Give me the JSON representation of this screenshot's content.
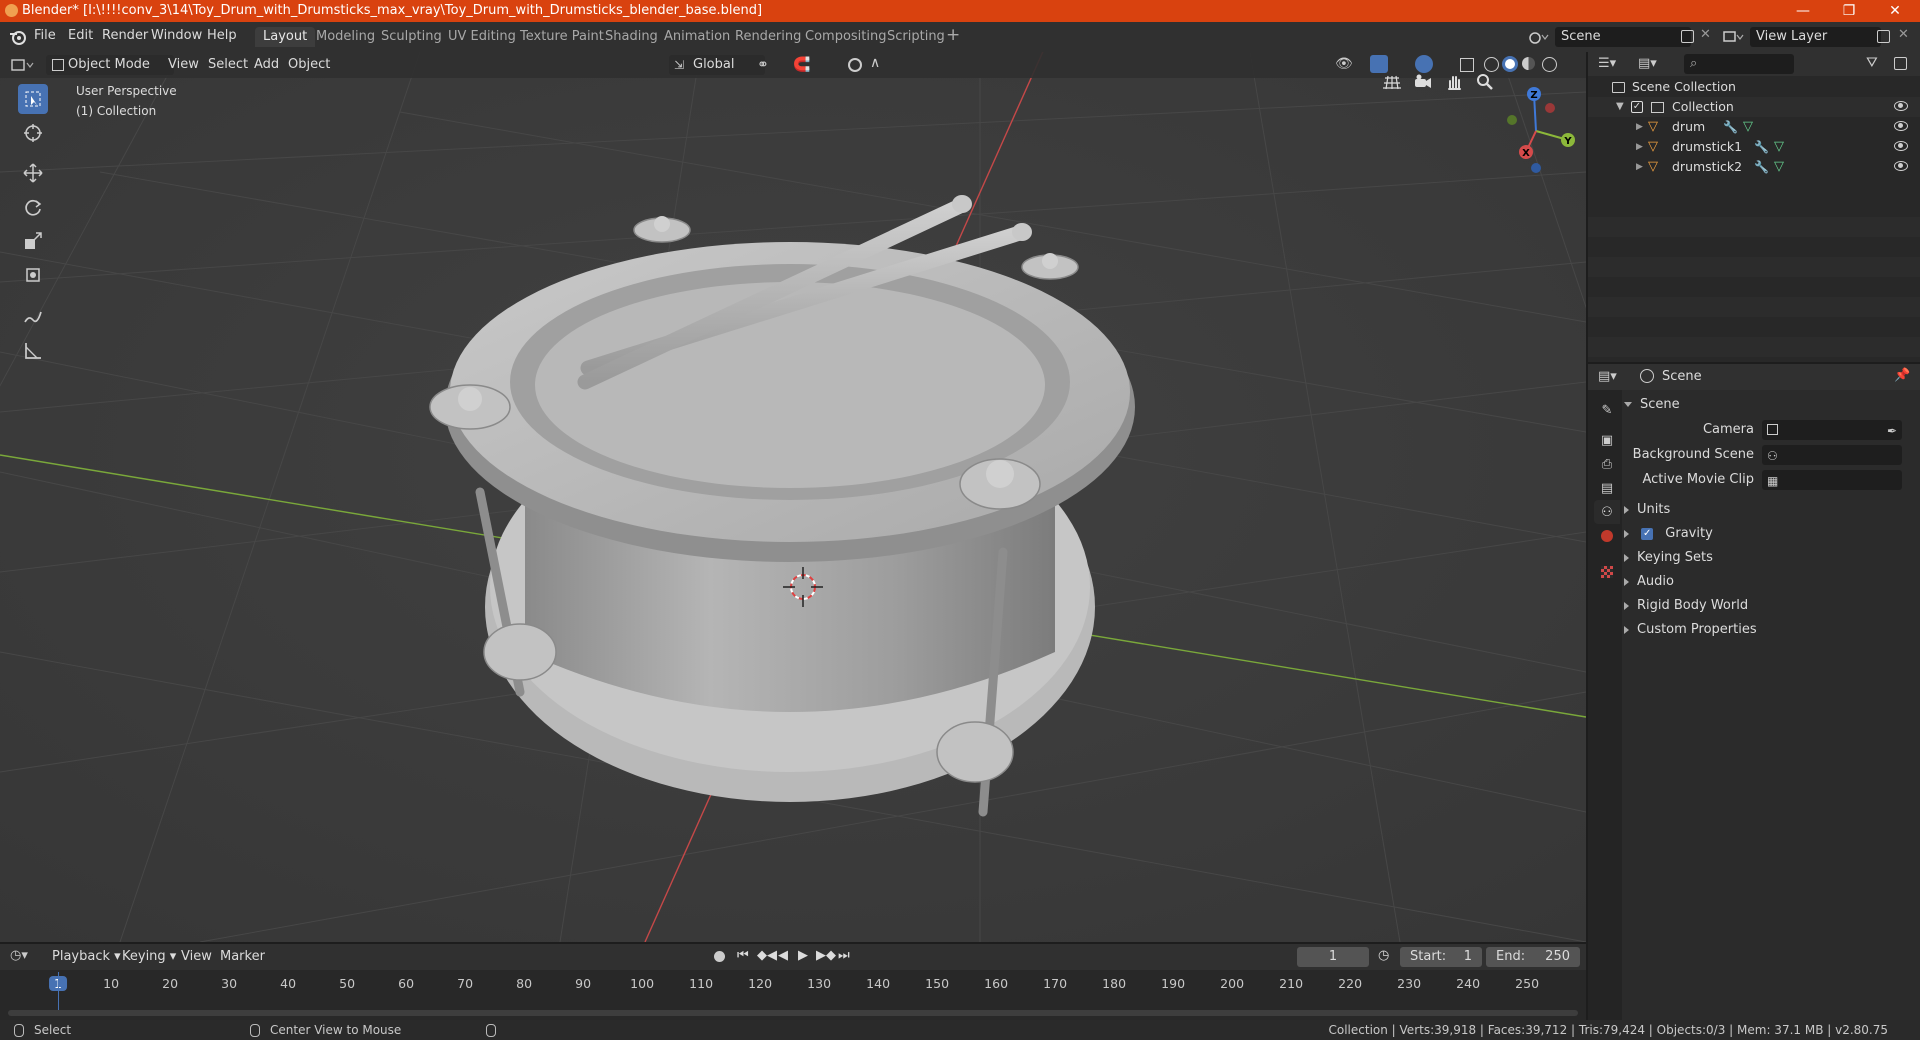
{
  "titlebar": {
    "title": "Blender* [I:\\!!!!conv_3\\14\\Toy_Drum_with_Drumsticks_max_vray\\Toy_Drum_with_Drumsticks_blender_base.blend]",
    "minimize": "—",
    "maximize": "❐",
    "close": "✕"
  },
  "menu": {
    "file": "File",
    "edit": "Edit",
    "render": "Render",
    "window": "Window",
    "help": "Help"
  },
  "workspaces": [
    "Layout",
    "Modeling",
    "Sculpting",
    "UV Editing",
    "Texture Paint",
    "Shading",
    "Animation",
    "Rendering",
    "Compositing",
    "Scripting"
  ],
  "add_workspace": "+",
  "scene_field": {
    "value": "Scene"
  },
  "view_layer_field": {
    "value": "View Layer"
  },
  "viewport_header": {
    "mode": "Object Mode",
    "view": "View",
    "select": "Select",
    "add": "Add",
    "object": "Object",
    "orientation": "Global"
  },
  "viewport": {
    "perspective": "User Perspective",
    "collection": "(1) Collection"
  },
  "gizmo": {
    "z": "Z",
    "y": "Y",
    "x": "X"
  },
  "outliner": {
    "root": "Scene Collection",
    "collection": "Collection",
    "items": [
      {
        "name": "drum"
      },
      {
        "name": "drumstick1"
      },
      {
        "name": "drumstick2"
      }
    ]
  },
  "properties": {
    "context": "Scene",
    "panel": "Scene",
    "fields": [
      {
        "label": "Camera"
      },
      {
        "label": "Background Scene"
      },
      {
        "label": "Active Movie Clip"
      }
    ],
    "sections": [
      "Units",
      "Gravity",
      "Keying Sets",
      "Audio",
      "Rigid Body World",
      "Custom Properties"
    ],
    "gravity_checked": true
  },
  "timeline": {
    "playback": "Playback",
    "keying": "Keying",
    "view": "View",
    "marker": "Marker",
    "current_frame": "1",
    "start_label": "Start:",
    "start": "1",
    "end_label": "End:",
    "end": "250",
    "ruler": [
      "1",
      "10",
      "20",
      "30",
      "40",
      "50",
      "60",
      "70",
      "80",
      "90",
      "100",
      "110",
      "120",
      "130",
      "140",
      "150",
      "160",
      "170",
      "180",
      "190",
      "200",
      "210",
      "220",
      "230",
      "240",
      "250"
    ]
  },
  "statusbar": {
    "select": "Select",
    "center_view": "Center View to Mouse",
    "stats": "Collection | Verts:39,918 | Faces:39,712 | Tris:79,424 | Objects:0/3 | Mem: 37.1 MB | v2.80.75"
  },
  "colors": {
    "titlebar": "#d9420f",
    "accent": "#4772b3",
    "x_axis": "#d54b4b",
    "y_axis": "#8cb83a",
    "z_axis": "#3f79d8"
  }
}
